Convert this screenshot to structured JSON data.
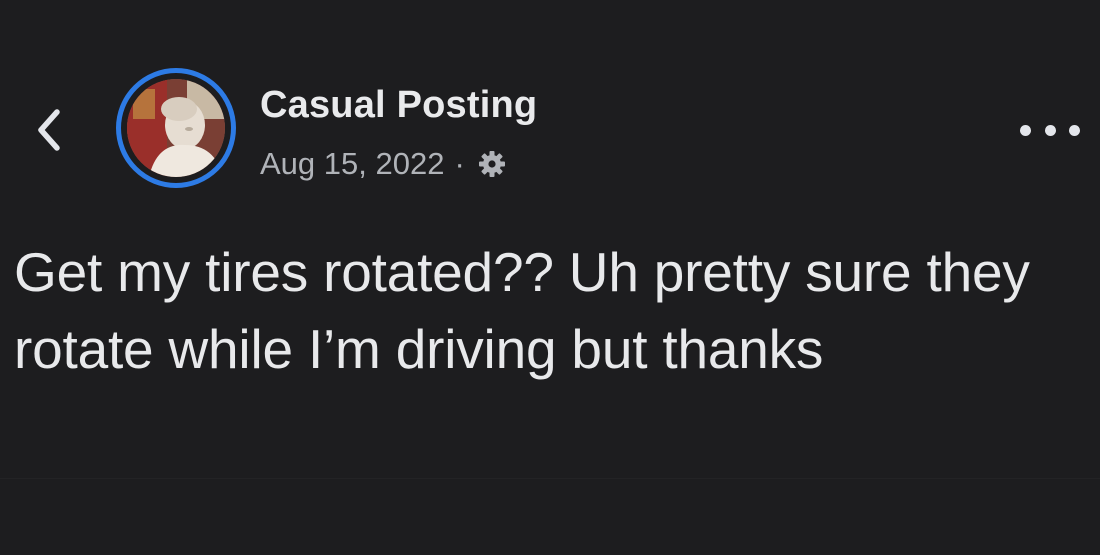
{
  "post": {
    "author": "Casual Posting",
    "date": "Aug 15, 2022",
    "separator": "·",
    "privacy_icon": "gear-icon",
    "text": "Get my tires rotated?? Uh pretty sure they rotate while I’m driving but thanks"
  },
  "icons": {
    "back": "chevron-left-icon",
    "more": "more-horizontal-icon"
  },
  "colors": {
    "background": "#1d1d1f",
    "story_ring": "#2d7be5",
    "primary_text": "#e4e6eb",
    "secondary_text": "#b0b3b8"
  }
}
